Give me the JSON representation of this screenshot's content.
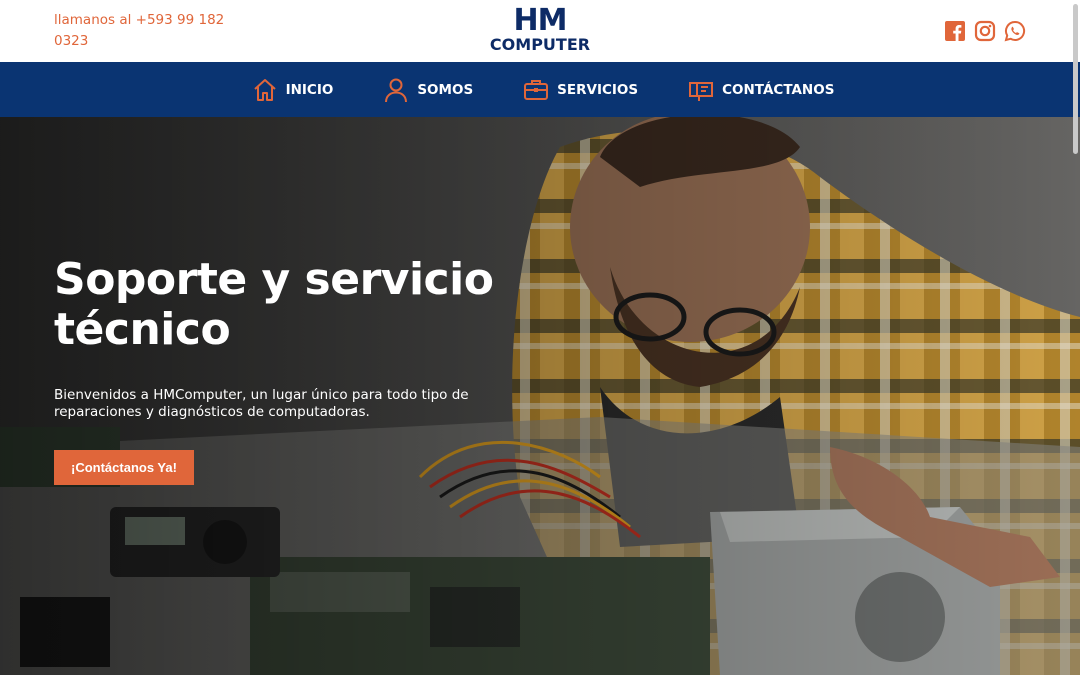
{
  "header": {
    "phone_text": "llamanos al +593 99 182 0323",
    "logo_line1": "HM",
    "logo_line2": "COMPUTER",
    "social_icons": [
      "facebook-icon",
      "instagram-icon",
      "whatsapp-icon"
    ],
    "icon_color": "#e0663a"
  },
  "nav": {
    "items": [
      {
        "label": "INICIO",
        "icon": "home-icon"
      },
      {
        "label": "SOMOS",
        "icon": "user-icon"
      },
      {
        "label": "SERVICIOS",
        "icon": "briefcase-icon"
      },
      {
        "label": "CONTÁCTANOS",
        "icon": "mailbox-icon"
      }
    ],
    "background": "#0a3472",
    "icon_color": "#e0663a"
  },
  "hero": {
    "title": "Soporte y servicio técnico",
    "text": "Bienvenidos a HMComputer, un lugar único para todo tipo de reparaciones y diagnósticos de computadoras.",
    "cta_label": "¡Contáctanos Ya!",
    "accent": "#e0663a"
  }
}
